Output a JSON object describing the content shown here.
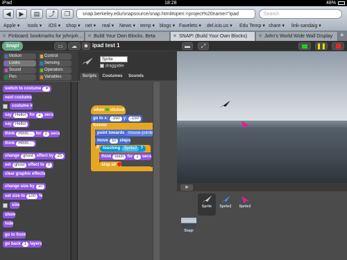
{
  "status": {
    "device": "iPad",
    "time": "18:28",
    "battery": "48%"
  },
  "safari": {
    "url": "snap.berkeley.edu/snapsource/snap.html#open:<project%20name=\"ipad",
    "search_placeholder": "Search",
    "bookmarks": [
      "Apple ▾",
      "tools ▾",
      "iOS ▾",
      "shop ▾",
      "net ▾",
      "real ▾",
      "News ▾",
      "temp ▾",
      "blogs ▾",
      "Favelets ▾",
      "del.icio.us ▾",
      "Edu Temp ▾",
      "share ▾",
      "link-sandaig ▾"
    ],
    "tabs": [
      "Pinboard: bookmarks for johnjoh…",
      "Build Your Own Blocks. Beta",
      "SNAP! (Build Your Own Blocks)",
      "John's World Wide Wall Display"
    ]
  },
  "snap": {
    "project_name": "ipad test 1",
    "categories": [
      "Motion",
      "Control",
      "Looks",
      "Sensing",
      "Sound",
      "Operators",
      "Pen",
      "Variables"
    ],
    "sprite_name": "Sprite",
    "draggable_label": "draggable",
    "sprite_tabs": [
      "Scripts",
      "Costumes",
      "Sounds"
    ],
    "palette": {
      "switch_costume": "switch to costume",
      "next_costume": "next costume",
      "costume_hash": "costume #",
      "say": "say",
      "for": "for",
      "secs": "secs",
      "think": "think",
      "hello": "Hello!",
      "hmm": "Hmm…",
      "two": "2",
      "change": "change",
      "effect_by": "effect by",
      "ghost": "ghost",
      "twenty_five": "25",
      "set": "set",
      "effect_to": "effect to",
      "zero": "0",
      "clear_effects": "clear graphic effects",
      "change_size_by": "change size by",
      "ten": "10",
      "set_size_to": "set size to",
      "percent": "%",
      "hundred": "100",
      "size": "size",
      "show": "show",
      "hide": "hide",
      "go_front": "go to front",
      "go_back": "go back",
      "one": "1",
      "layers": "layers"
    },
    "script": {
      "when": "when",
      "clicked": "clicked",
      "goto_x": "go to x:",
      "x_val": "-150",
      "y_label": "y:",
      "y_val": "-150",
      "forever": "forever",
      "point_towards": "point towards",
      "mouse_pointer": "mouse-pointer",
      "move": "move",
      "steps_val": "10",
      "steps": "steps",
      "if": "if",
      "touching": "touching",
      "sprite2": "Sprite2",
      "q": "?",
      "think": "think",
      "ouch": "ouch",
      "for": "for",
      "two": "2",
      "secs": "secs",
      "stop_all": "stop all"
    },
    "sprites": [
      "Sprite",
      "Sprite2",
      "Sprite3"
    ],
    "stage_label": "Stage"
  },
  "colors": {
    "motion": "#4a6cd4",
    "looks": "#8f56e3",
    "sound": "#cf4ad9",
    "control": "#e6a822",
    "sensing": "#0094d9",
    "operators": "#62c213"
  }
}
